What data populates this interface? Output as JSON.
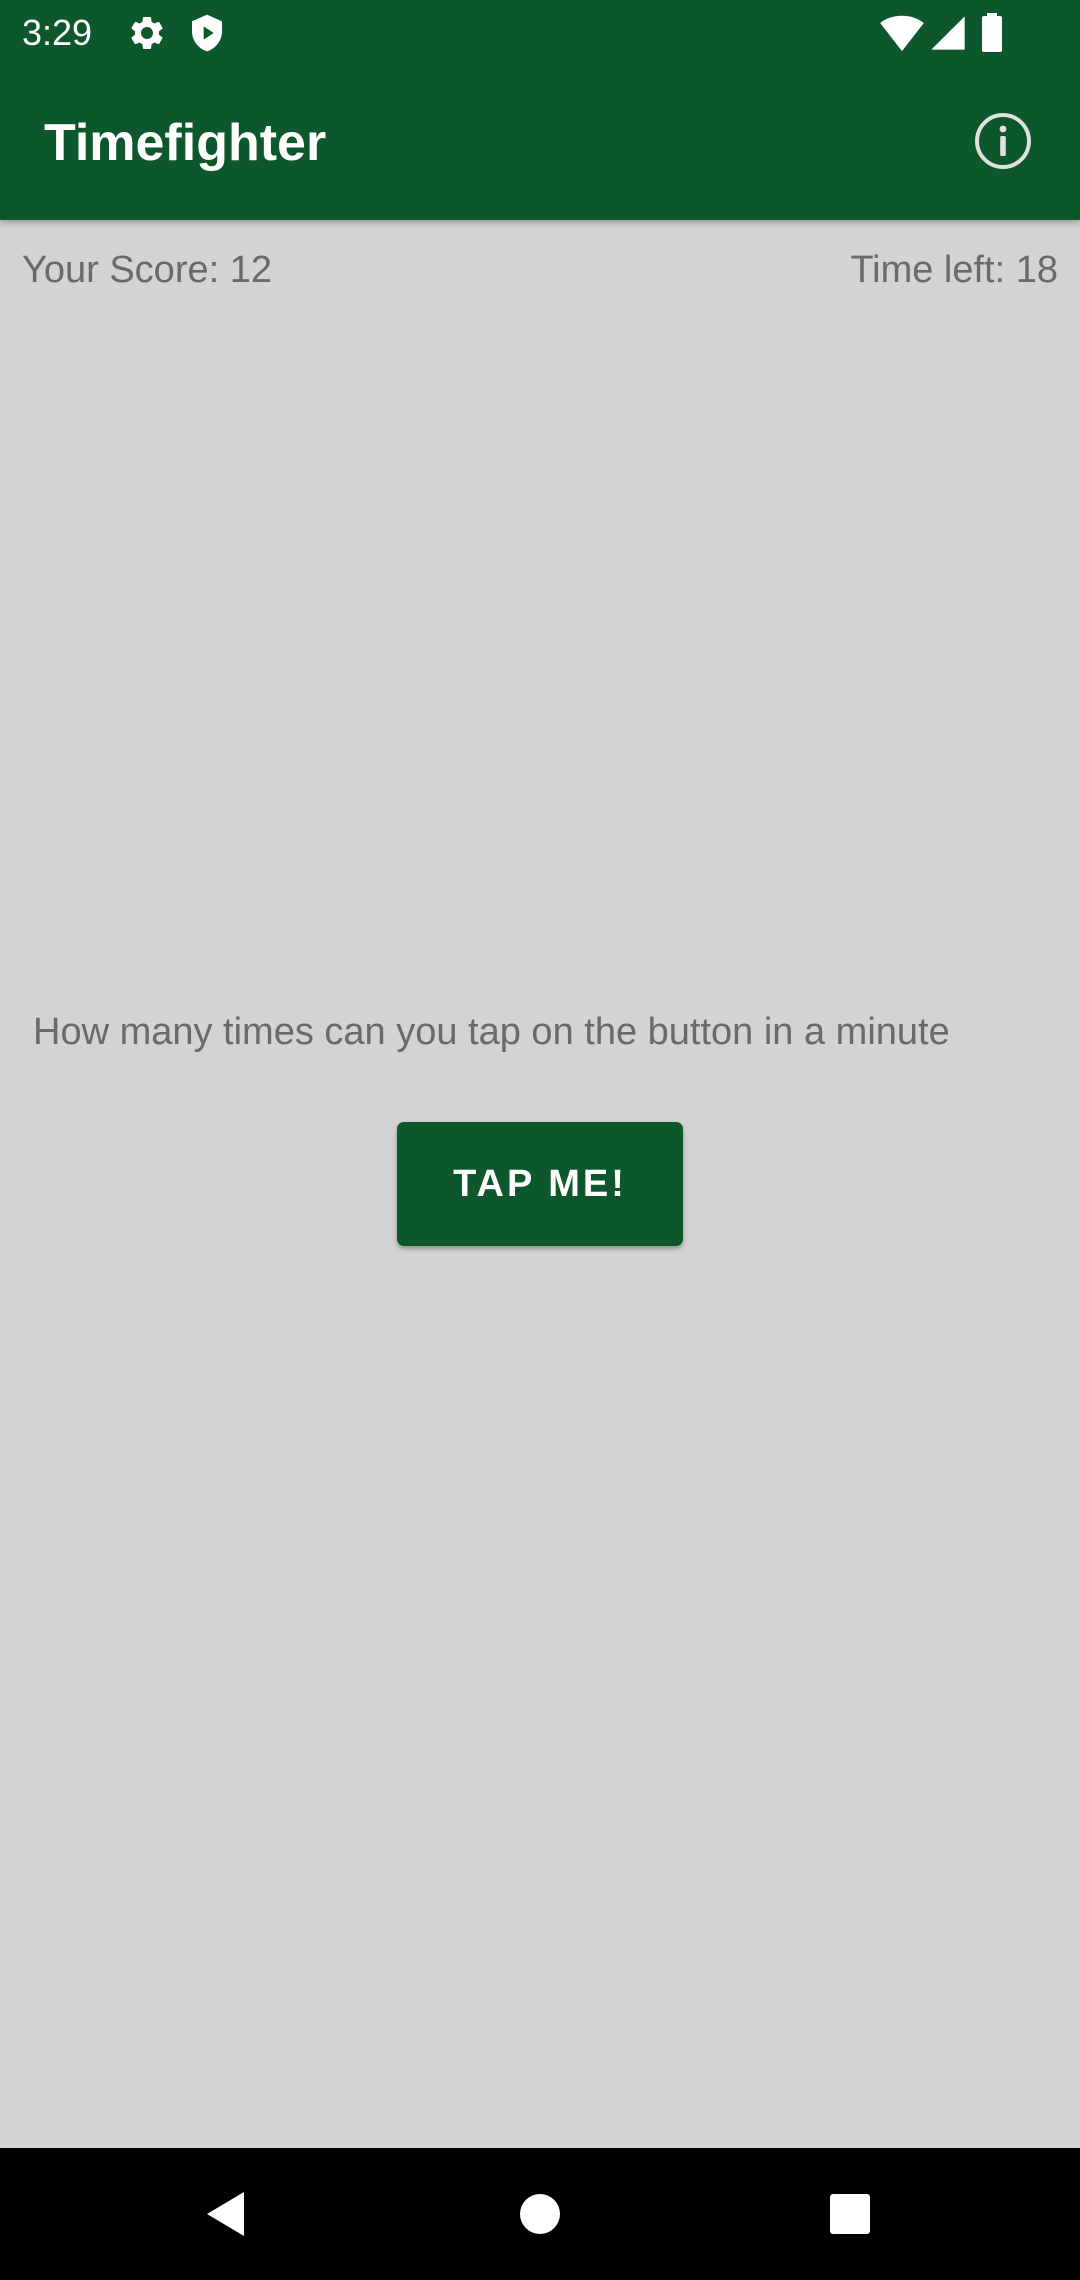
{
  "status_bar": {
    "time": "3:29",
    "left_icons": [
      "gear-icon",
      "shield-play-icon"
    ],
    "right_icons": [
      "wifi-icon",
      "cellular-signal-icon",
      "battery-icon"
    ]
  },
  "app_bar": {
    "title": "Timefighter",
    "action_icon": "info-icon"
  },
  "game": {
    "score_label": "Your Score: 12",
    "time_label": "Time left: 18",
    "prompt": "How many times can you tap on the button in a minute",
    "tap_button_label": "TAP ME!"
  },
  "nav_bar": {
    "buttons": [
      "back-icon",
      "home-icon",
      "recents-icon"
    ]
  },
  "colors": {
    "primary": "#0C572B",
    "background": "#D3D3D3",
    "secondary_text": "#6A6A6A",
    "on_primary": "#FFFFFF",
    "nav_background": "#000000"
  }
}
